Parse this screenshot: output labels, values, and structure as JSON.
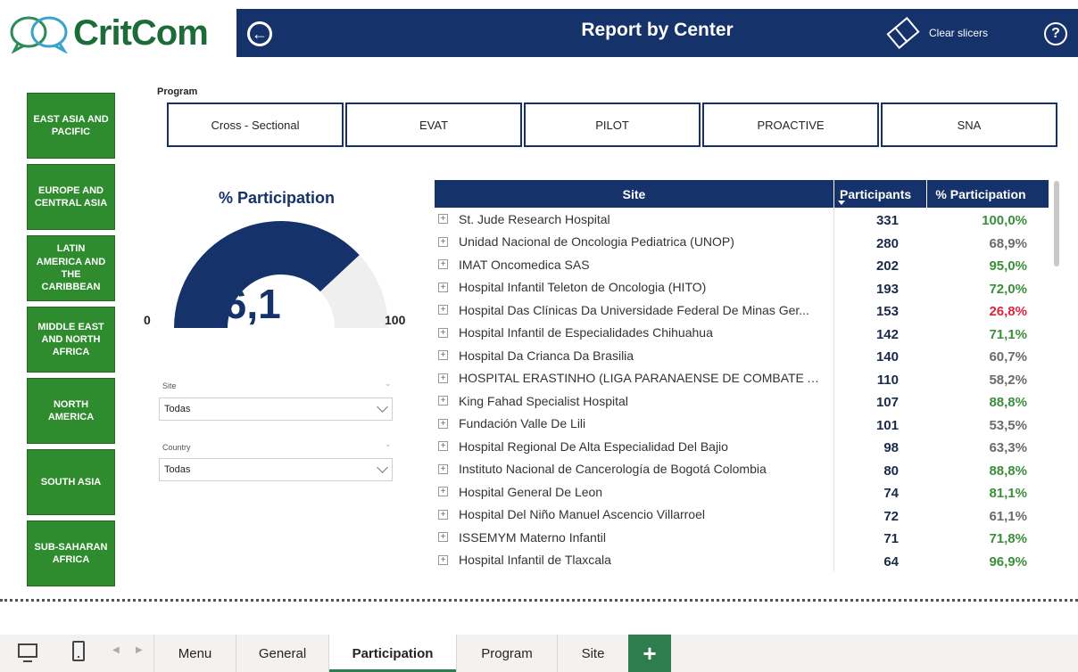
{
  "logo": {
    "text": "CritCom"
  },
  "header": {
    "title": "Report by Center",
    "back_icon": "arrow-left-circle-icon",
    "clear_label": "Clear slicers",
    "help_label": "?"
  },
  "regions": [
    "EAST ASIA AND PACIFIC",
    "EUROPE AND CENTRAL ASIA",
    "LATIN AMERICA AND THE CARIBBEAN",
    "MIDDLE EAST AND NORTH AFRICA",
    "NORTH AMERICA",
    "SOUTH ASIA",
    "SUB-SAHARAN AFRICA"
  ],
  "program": {
    "label": "Program",
    "options": [
      "Cross - Sectional",
      "EVAT",
      "PILOT",
      "PROACTIVE",
      "SNA"
    ]
  },
  "gauge": {
    "title": "% Participation",
    "value_text": "76,1",
    "value": 76.1,
    "min": "0",
    "max": "100",
    "fill_color": "#16326b",
    "track_color": "#efefef"
  },
  "filters": {
    "site": {
      "label": "Site",
      "value": "Todas"
    },
    "country": {
      "label": "Country",
      "value": "Todas"
    }
  },
  "table": {
    "headers": {
      "site": "Site",
      "participants": "Participants",
      "pct": "% Participation"
    },
    "colors": {
      "green": "#3a8f3a",
      "gray": "#6b6b6b",
      "red": "#e0243c"
    },
    "rows": [
      {
        "site": "St. Jude Research Hospital",
        "participants": "331",
        "pct": "100,0%",
        "color": "green"
      },
      {
        "site": "Unidad Nacional de Oncologia Pediatrica (UNOP)",
        "participants": "280",
        "pct": "68,9%",
        "color": "gray"
      },
      {
        "site": "IMAT Oncomedica SAS",
        "participants": "202",
        "pct": "95,0%",
        "color": "green"
      },
      {
        "site": "Hospital Infantil Teleton de Oncologia (HITO)",
        "participants": "193",
        "pct": "72,0%",
        "color": "green"
      },
      {
        "site": "Hospital Das Clínicas Da Universidade Federal De Minas Ger...",
        "participants": "153",
        "pct": "26,8%",
        "color": "red"
      },
      {
        "site": "Hospital Infantil de Especialidades Chihuahua",
        "participants": "142",
        "pct": "71,1%",
        "color": "green"
      },
      {
        "site": "Hospital Da Crianca Da Brasilia",
        "participants": "140",
        "pct": "60,7%",
        "color": "gray"
      },
      {
        "site": "HOSPITAL ERASTINHO (LIGA PARANAENSE DE COMBATE A...",
        "participants": "110",
        "pct": "58,2%",
        "color": "gray"
      },
      {
        "site": "King Fahad Specialist Hospital",
        "participants": "107",
        "pct": "88,8%",
        "color": "green"
      },
      {
        "site": "Fundación Valle De Lili",
        "participants": "101",
        "pct": "53,5%",
        "color": "gray"
      },
      {
        "site": "Hospital Regional De Alta Especialidad Del Bajio",
        "participants": "98",
        "pct": "63,3%",
        "color": "gray"
      },
      {
        "site": "Instituto Nacional de Cancerología de Bogotá Colombia",
        "participants": "80",
        "pct": "88,8%",
        "color": "green"
      },
      {
        "site": "Hospital General De Leon",
        "participants": "74",
        "pct": "81,1%",
        "color": "green"
      },
      {
        "site": "Hospital Del Niño Manuel Ascencio Villarroel",
        "participants": "72",
        "pct": "61,1%",
        "color": "gray"
      },
      {
        "site": "ISSEMYM Materno Infantil",
        "participants": "71",
        "pct": "71,8%",
        "color": "green"
      },
      {
        "site": "Hospital Infantil de Tlaxcala",
        "participants": "64",
        "pct": "96,9%",
        "color": "green"
      }
    ]
  },
  "tabs": {
    "items": [
      "Menu",
      "General",
      "Participation",
      "Program",
      "Site"
    ],
    "active": "Participation",
    "add_label": "+"
  }
}
